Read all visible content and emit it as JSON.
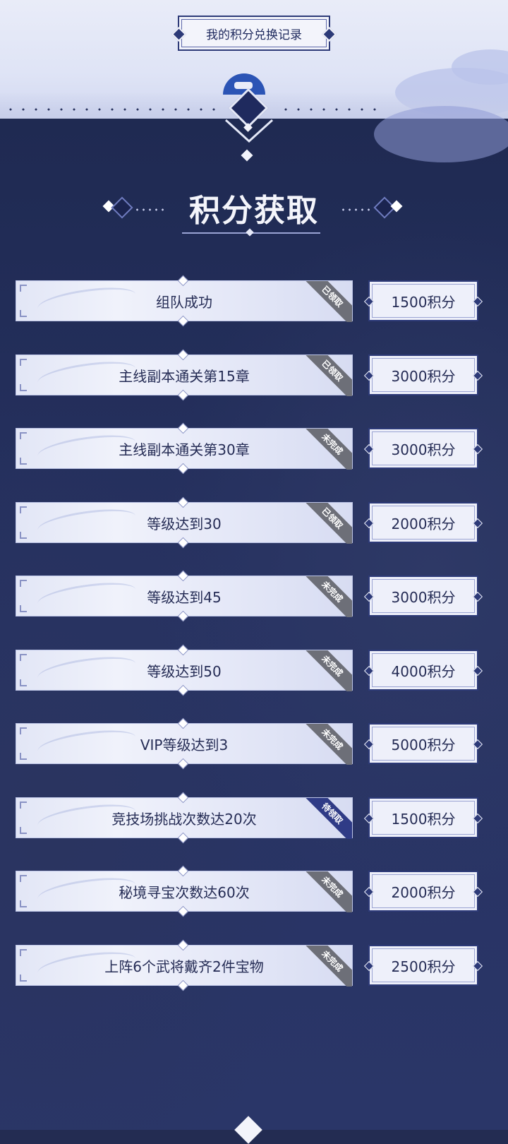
{
  "header": {
    "record_button_label": "我的积分兑换记录"
  },
  "section": {
    "title": "积分获取"
  },
  "tasks": [
    {
      "name": "组队成功",
      "status": "已领取",
      "points": "1500积分"
    },
    {
      "name": "主线副本通关第15章",
      "status": "已领取",
      "points": "3000积分"
    },
    {
      "name": "主线副本通关第30章",
      "status": "未完成",
      "points": "3000积分"
    },
    {
      "name": "等级达到30",
      "status": "已领取",
      "points": "2000积分"
    },
    {
      "name": "等级达到45",
      "status": "未完成",
      "points": "3000积分"
    },
    {
      "name": "等级达到50",
      "status": "未完成",
      "points": "4000积分"
    },
    {
      "name": "VIP等级达到3",
      "status": "未完成",
      "points": "5000积分"
    },
    {
      "name": "竞技场挑战次数达20次",
      "status": "待领取",
      "points": "1500积分"
    },
    {
      "name": "秘境寻宝次数达60次",
      "status": "未完成",
      "points": "2000积分"
    },
    {
      "name": "上阵6个武将戴齐2件宝物",
      "status": "未完成",
      "points": "2500积分"
    }
  ],
  "colors": {
    "background": "#232c52",
    "accent": "#2d3a78",
    "pending_ribbon": "#2f3b86",
    "done_ribbon": "#6d6f78"
  }
}
